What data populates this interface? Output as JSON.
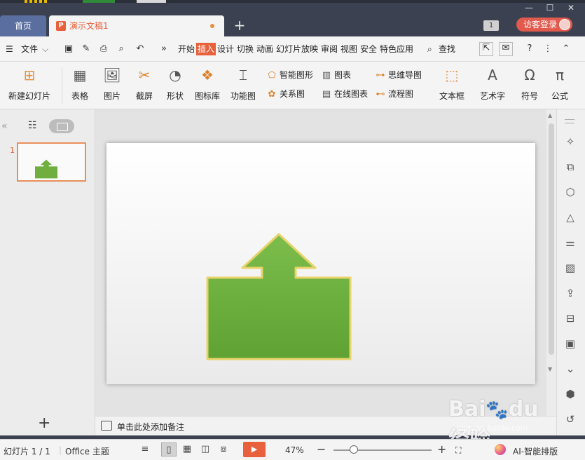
{
  "window": {
    "tabs": {
      "home": "首页",
      "document": "演示文稿1"
    },
    "tab_count_badge": "1",
    "login_label": "访客登录",
    "colors": {
      "accent": "#e8603c",
      "titlebar": "#3b4150",
      "shape_fill": "#6fae3f",
      "shape_glow": "#e7d36a"
    }
  },
  "menu": {
    "file_label": "文件",
    "more": "»",
    "tabs": [
      "开始",
      "插入",
      "设计",
      "切换",
      "动画",
      "幻灯片放映",
      "审阅",
      "视图",
      "安全",
      "特色应用"
    ],
    "active_tab": "插入",
    "search_label": "查找"
  },
  "ribbon": {
    "new_slide": "新建幻灯片",
    "table": "表格",
    "picture": "图片",
    "screenshot": "截屏",
    "shape": "形状",
    "icon_library": "图标库",
    "function_chart": "功能图",
    "smart_graphic": "智能图形",
    "relation_chart": "关系图",
    "chart": "图表",
    "online_chart": "在线图表",
    "mind_map": "思维导图",
    "flowchart": "流程图",
    "textbox": "文本框",
    "wordart": "艺术字",
    "symbol": "符号",
    "formula": "公式"
  },
  "slides_panel": {
    "slide_number": "1"
  },
  "notes": {
    "placeholder": "单击此处添加备注"
  },
  "status": {
    "slide_counter": "幻灯片 1 / 1",
    "theme": "Office 主题",
    "zoom": "47%",
    "zoom_fraction": 0.47,
    "ai_layout": "AI-智能排版"
  },
  "watermark": {
    "main": "Bai du 经验",
    "sub": "jingyan.baidu.com"
  }
}
